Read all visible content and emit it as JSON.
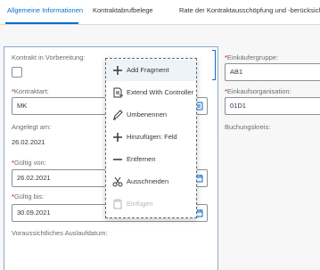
{
  "tabs": [
    {
      "label": "Allgemeine Informationen",
      "active": true
    },
    {
      "label": "Kontraktabrufbelege",
      "active": false
    },
    {
      "label": "Rate der Kontraktausschöpfung und -berücksichtigung",
      "active": false
    }
  ],
  "form": {
    "left": {
      "kontrakt_in_vorbereitung": {
        "label": "Kontrakt in Vorbereitung:",
        "checked": false
      },
      "kontraktart": {
        "required_mark": "*",
        "label": "Kontraktart:",
        "value": "MK"
      },
      "angelegt_am": {
        "label": "Angelegt am:",
        "value": "26.02.2021"
      },
      "gueltig_von": {
        "required_mark": "*",
        "label": "Gültig von:",
        "value": "26.02.2021"
      },
      "gueltig_bis": {
        "required_mark": "*",
        "label": "Gültig bis:",
        "value": "30.09.2021"
      },
      "voraussichtliches_auslaufdatum": {
        "label": "Voraussichtliches Auslaufdatum:"
      }
    },
    "right": {
      "einkaeufergruppe": {
        "required_mark": "*",
        "label": "Einkäufergruppe:",
        "value": "AB1"
      },
      "einkaufsorganisation": {
        "required_mark": "*",
        "label": "Einkaufsorganisation:",
        "value": "01D1"
      },
      "buchungskreis": {
        "label": "Buchungskreis:"
      }
    }
  },
  "context_menu": {
    "items": [
      {
        "label": "Add Fragment",
        "icon": "add-icon",
        "state": "hover"
      },
      {
        "label": "Extend With Controller",
        "icon": "extend-controller-icon",
        "state": "normal"
      },
      {
        "label": "Umbenennen",
        "icon": "edit-icon",
        "state": "normal"
      },
      {
        "label": "Hinzufügen: Feld",
        "icon": "add-icon",
        "state": "normal"
      },
      {
        "label": "Entfernen",
        "icon": "less-icon",
        "state": "normal"
      },
      {
        "label": "Ausschneiden",
        "icon": "scissors-icon",
        "state": "normal"
      },
      {
        "label": "Einfügen",
        "icon": "paste-icon",
        "state": "disabled"
      }
    ]
  },
  "colors": {
    "accent": "#0a6ed1",
    "required": "#bb0000",
    "label": "#6a6d70",
    "text": "#32363a",
    "disabled": "#b3b6b9"
  }
}
